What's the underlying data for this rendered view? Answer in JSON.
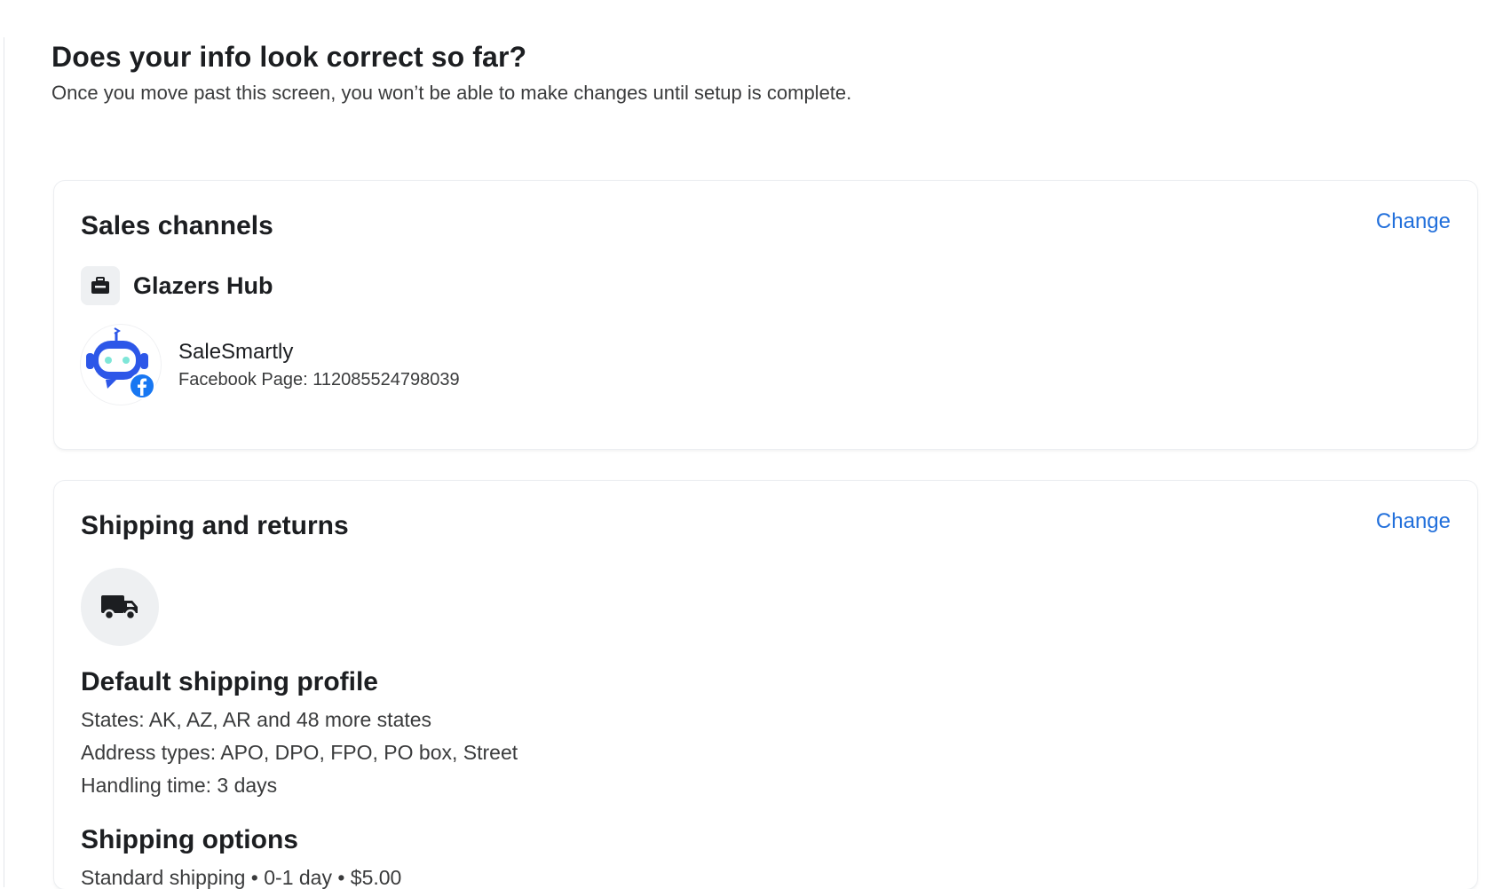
{
  "header": {
    "title": "Does your info look correct so far?",
    "subtitle": "Once you move past this screen, you won’t be able to make changes until setup is complete."
  },
  "sales_channels": {
    "title": "Sales channels",
    "change_label": "Change",
    "shop": {
      "icon": "shop-icon",
      "name": "Glazers Hub"
    },
    "page": {
      "avatar_icon": "robot-icon",
      "badge_icon": "facebook-icon",
      "name": "SaleSmartly",
      "id_text": "Facebook Page: 112085524798039"
    }
  },
  "shipping": {
    "title": "Shipping and returns",
    "change_label": "Change",
    "icon": "truck-icon",
    "profile_title": "Default shipping profile",
    "states": "States: AK, AZ, AR and 48 more states",
    "address_types": "Address types: APO, DPO, FPO, PO box, Street",
    "handling_time": "Handling time: 3 days",
    "options_title": "Shipping options",
    "option_1": "Standard shipping • 0-1 day • $5.00"
  },
  "colors": {
    "link": "#216fdb",
    "robot_blue": "#2d57e8",
    "facebook_blue": "#1877f2",
    "robot_eye": "#7fe6d8"
  }
}
